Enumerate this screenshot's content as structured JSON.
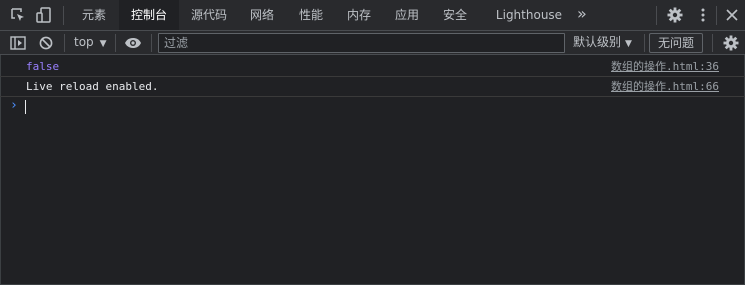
{
  "tabbar": {
    "icons": {
      "inspect": "select-element-icon",
      "device": "device-toggle-icon",
      "more_tabs": "chevron-double-right-icon",
      "settings": "gear-icon",
      "menu": "kebab-menu-icon",
      "close": "close-icon"
    },
    "tabs": [
      {
        "label": "元素",
        "active": false
      },
      {
        "label": "控制台",
        "active": true
      },
      {
        "label": "源代码",
        "active": false
      },
      {
        "label": "网络",
        "active": false
      },
      {
        "label": "性能",
        "active": false
      },
      {
        "label": "内存",
        "active": false
      },
      {
        "label": "应用",
        "active": false
      },
      {
        "label": "安全",
        "active": false
      },
      {
        "label": "Lighthouse",
        "active": false
      }
    ],
    "more_label": "»"
  },
  "toolbar": {
    "context": "top",
    "filter_placeholder": "过滤",
    "levels": "默认级别",
    "issues": "无问题"
  },
  "console": {
    "messages": [
      {
        "text": "false",
        "type": "boolean",
        "source": "数组的操作.html:36"
      },
      {
        "text": "Live reload enabled.",
        "type": "log",
        "source": "数组的操作.html:66"
      }
    ],
    "prompt_symbol": "›"
  },
  "colors": {
    "background": "#202124",
    "toolbar": "#292a2d",
    "boolean": "#9980ff",
    "prompt": "#4d90fe"
  }
}
